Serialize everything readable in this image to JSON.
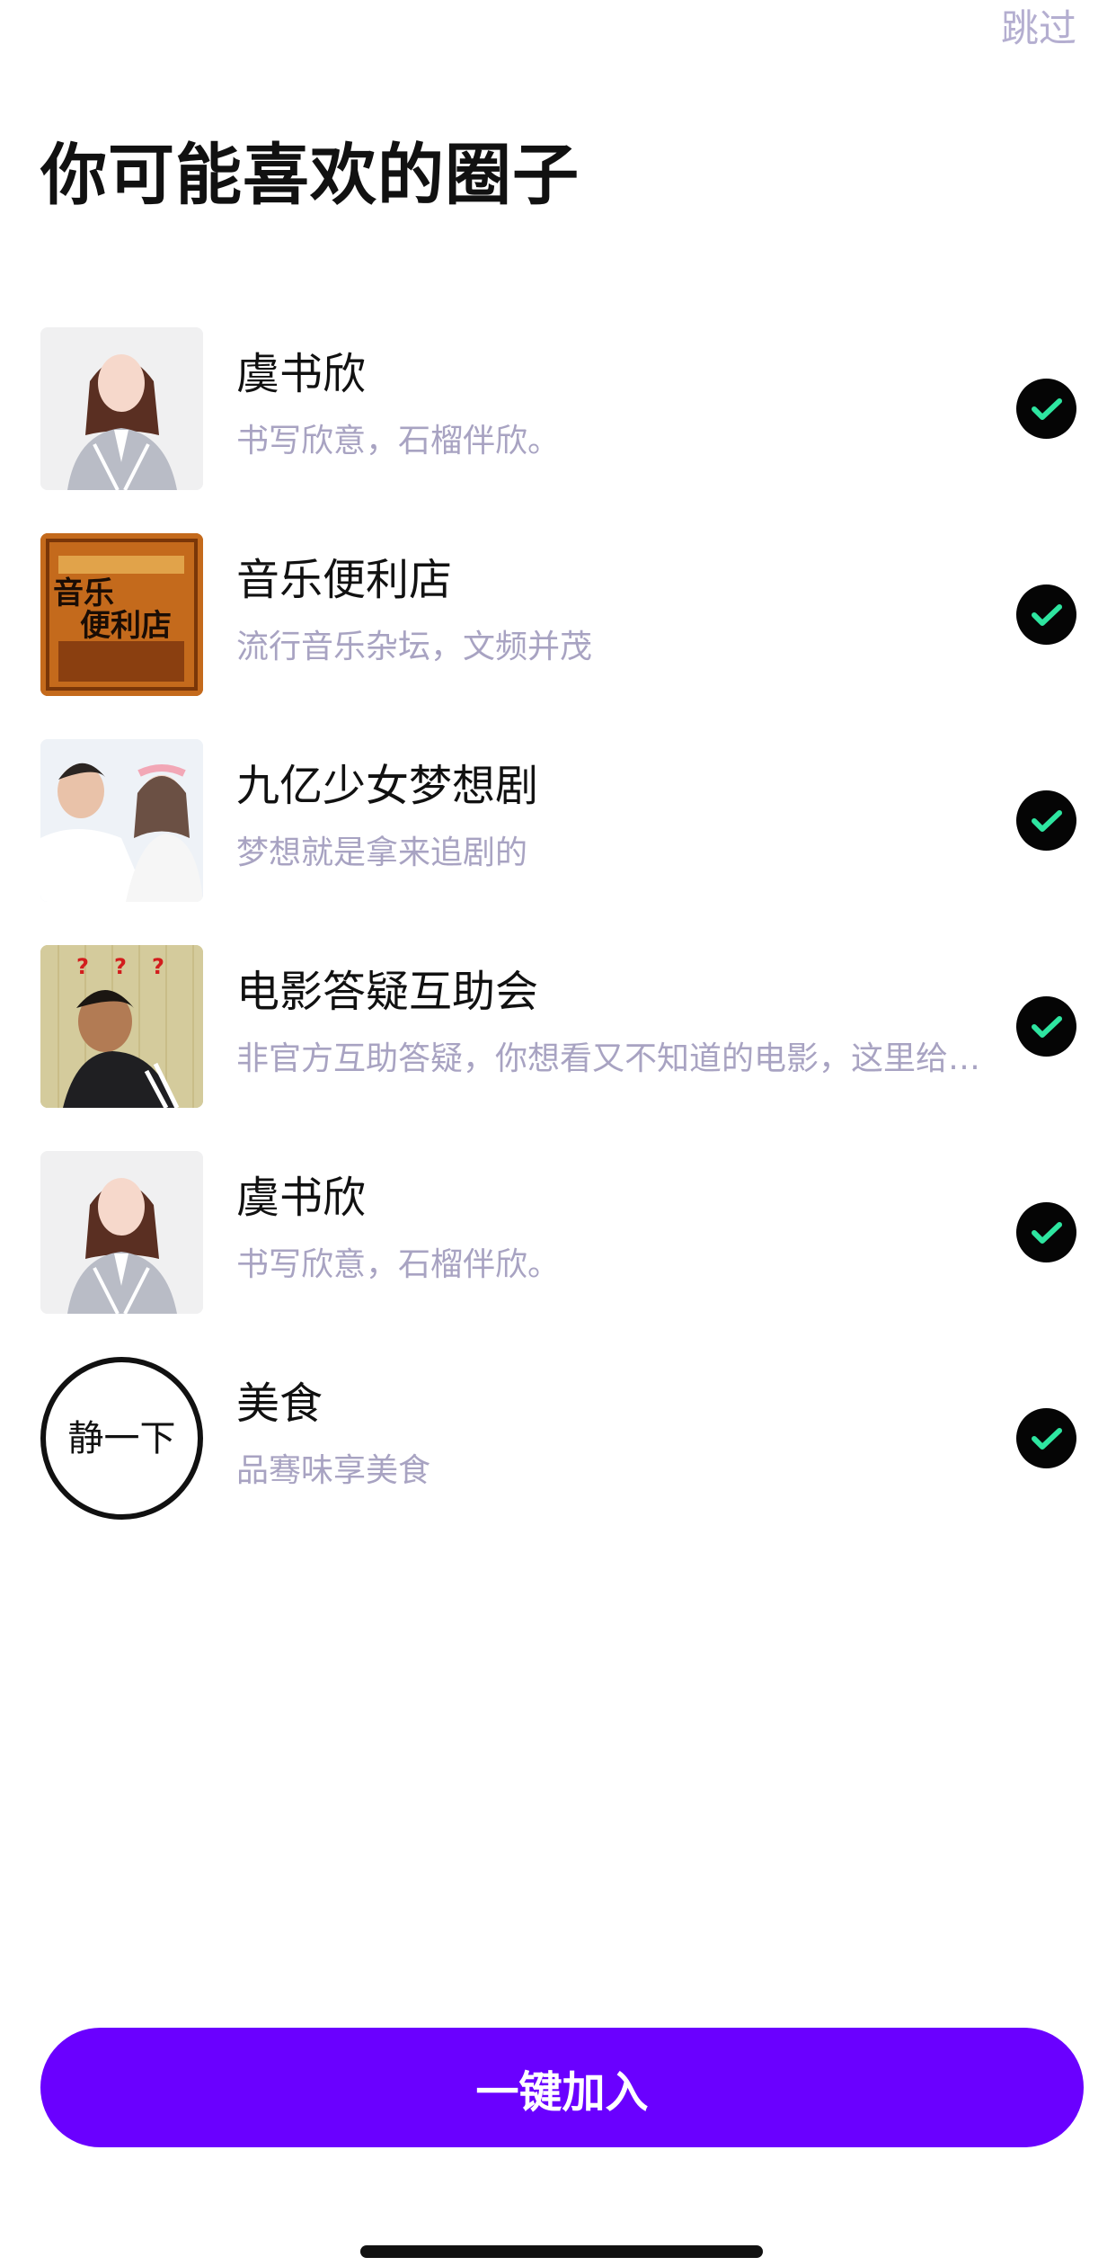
{
  "header": {
    "skip_label": "跳过",
    "title": "你可能喜欢的圈子"
  },
  "circles": [
    {
      "name": "虞书欣",
      "desc": "书写欣意，石榴伴欣。",
      "selected": true,
      "thumb_icon": "person-portrait"
    },
    {
      "name": "音乐便利店",
      "desc": "流行音乐杂坛，文频并茂",
      "selected": true,
      "thumb_icon": "music-store-poster",
      "thumb_text": [
        "音乐",
        "便利店"
      ]
    },
    {
      "name": "九亿少女梦想剧",
      "desc": "梦想就是拿来追剧的",
      "selected": true,
      "thumb_icon": "drama-couple"
    },
    {
      "name": "电影答疑互助会",
      "desc": "非官方互助答疑，你想看又不知道的电影，这里给你找",
      "selected": true,
      "thumb_icon": "confused-boy",
      "thumb_text": [
        "?",
        "?",
        "?"
      ]
    },
    {
      "name": "虞书欣",
      "desc": "书写欣意，石榴伴欣。",
      "selected": true,
      "thumb_icon": "person-portrait"
    },
    {
      "name": "美食",
      "desc": "品骞味享美食",
      "selected": true,
      "thumb_icon": "calm-circle-logo",
      "thumb_text": [
        "静一下"
      ]
    }
  ],
  "cta": {
    "label": "一键加入"
  },
  "colors": {
    "accent": "#6a00ff",
    "check_fill": "#050505",
    "check_mark": "#2ee5a0",
    "muted": "#a8a3c2"
  }
}
